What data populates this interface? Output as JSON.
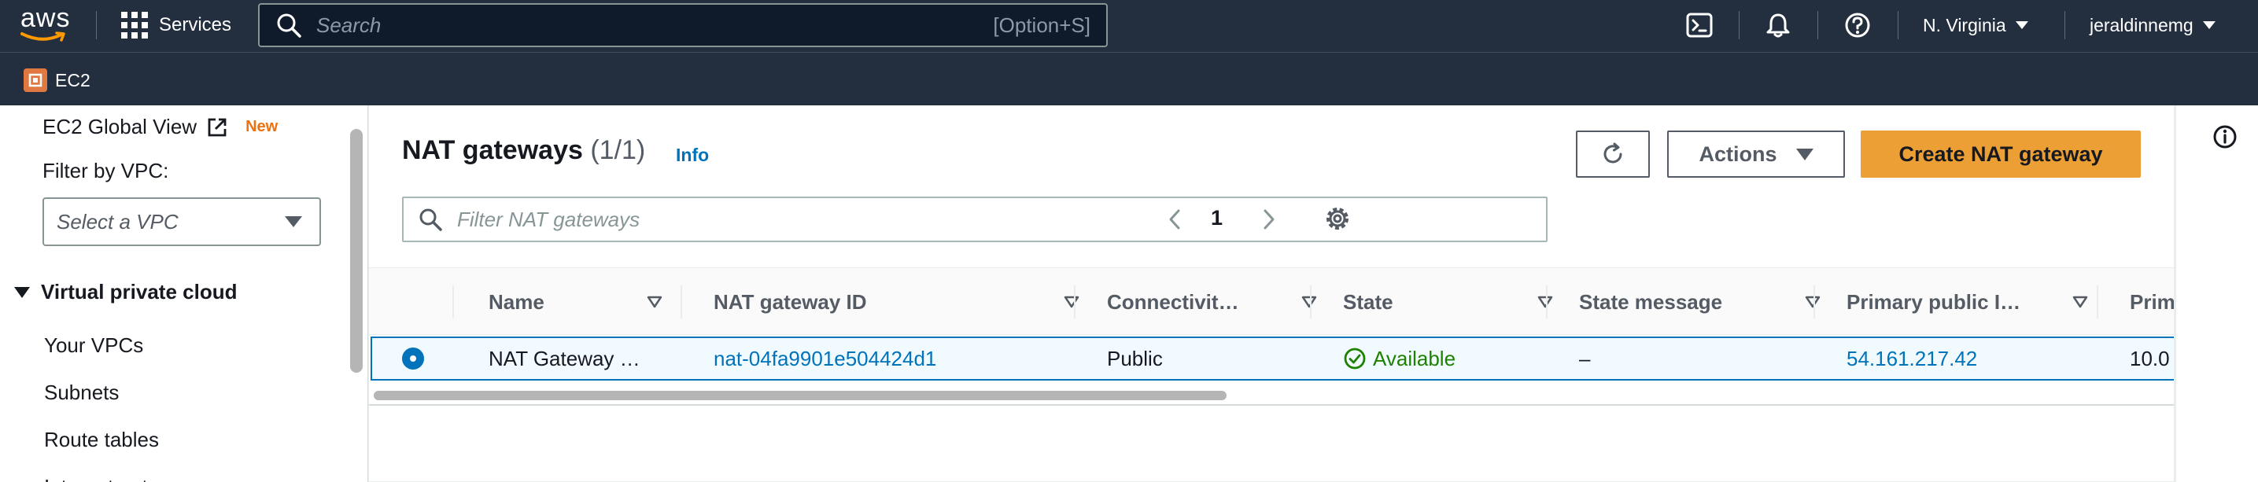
{
  "topnav": {
    "logo_text": "aws",
    "services_label": "Services",
    "search_placeholder": "Search",
    "search_shortcut": "[Option+S]",
    "icons": [
      "cloudshell-icon",
      "bell-icon",
      "help-icon"
    ],
    "region": "N. Virginia",
    "user": "jeraldinnemg"
  },
  "servicebar": {
    "service": "EC2"
  },
  "sidebar": {
    "global_view": "EC2 Global View",
    "new_badge": "New",
    "filter_label": "Filter by VPC:",
    "filter_placeholder": "Select a VPC",
    "section": "Virtual private cloud",
    "items": [
      "Your VPCs",
      "Subnets",
      "Route tables",
      "Internet gateways"
    ]
  },
  "main": {
    "title": "NAT gateways",
    "count": "(1/1)",
    "info": "Info",
    "actions_label": "Actions",
    "create_label": "Create NAT gateway",
    "filter_placeholder": "Filter NAT gateways",
    "page": "1",
    "columns": [
      "Name",
      "NAT gateway ID",
      "Connectivit…",
      "State",
      "State message",
      "Primary public I…",
      "Prim"
    ],
    "row": {
      "name": "NAT Gateway …",
      "id": "nat-04fa9901e504424d1",
      "connectivity": "Public",
      "state": "Available",
      "state_message": "–",
      "primary_public_ip": "54.161.217.42",
      "primary_private": "10.0"
    }
  },
  "colors": {
    "nav_bg": "#232f3e",
    "primary_button": "#ec9f34",
    "link": "#0073bb",
    "success": "#1d8102",
    "ec2_badge": "#e07941"
  }
}
